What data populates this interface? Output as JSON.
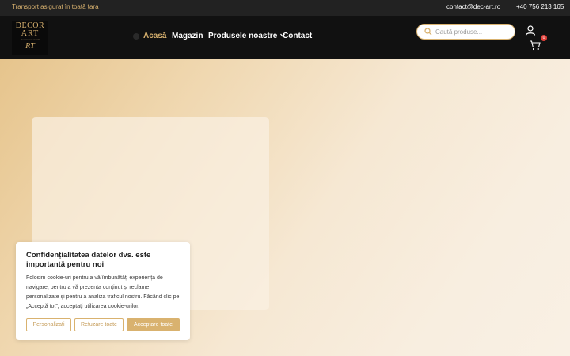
{
  "topbar": {
    "shipping_text": "Transport asigurat în toată țara",
    "email": "contact@dec-art.ro",
    "phone": "+40 756 213 165"
  },
  "logo": {
    "line1": "DECOR",
    "line2": "ART",
    "tagline": "Decorațiuni cu stil",
    "monogram": "RT"
  },
  "nav": {
    "items": [
      {
        "label": "Acasă",
        "active": true
      },
      {
        "label": "Magazin",
        "active": false
      },
      {
        "label": "Produsele noastre",
        "active": false,
        "has_dropdown": true
      },
      {
        "label": "Contact",
        "active": false
      }
    ]
  },
  "search": {
    "placeholder": "Caută produse..."
  },
  "cart": {
    "count": "0"
  },
  "cookie": {
    "title": "Confidențialitatea datelor dvs. este importantă pentru noi",
    "body": "Folosim cookie-uri pentru a vă îmbunătăți experiența de navigare, pentru a vă prezenta conținut și reclame personalizate și pentru a analiza traficul nostru. Făcând clic pe „Acceptă tot”, acceptați utilizarea cookie-urilor.",
    "customize_label": "Personalizați",
    "reject_label": "Refuzare toate",
    "accept_label": "Acceptare toate"
  },
  "colors": {
    "accent": "#d9b26f",
    "header_bg": "#111111",
    "topbar_bg": "#222222",
    "badge": "#e0403a"
  }
}
